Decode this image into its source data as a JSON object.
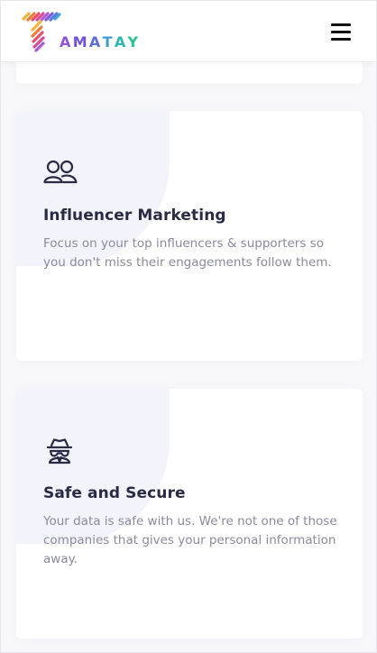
{
  "brand": {
    "name": "TAMATAY",
    "letters": [
      "A",
      "M",
      "A",
      "T",
      "A",
      "Y"
    ],
    "letter_colors": [
      "#8f56d9",
      "#6f50d8",
      "#5c6ed6",
      "#3f9bd0",
      "#2fb6b2",
      "#26c28e"
    ]
  },
  "header": {
    "menu_icon": "hamburger-menu-icon"
  },
  "features": [
    {
      "icon": "users-icon",
      "title": "Influencer Marketing",
      "description": "Focus on your top influencers & supporters so you don't miss their engagements follow them."
    },
    {
      "icon": "spy-icon",
      "title": "Safe and Secure",
      "description": "Your data is safe with us. We're not one of those companies that gives your personal information away."
    }
  ],
  "colors": {
    "title": "#2a2a45",
    "description": "#8a8a9c",
    "blob": "#f3f3fb",
    "icon": "#2a2a45"
  }
}
